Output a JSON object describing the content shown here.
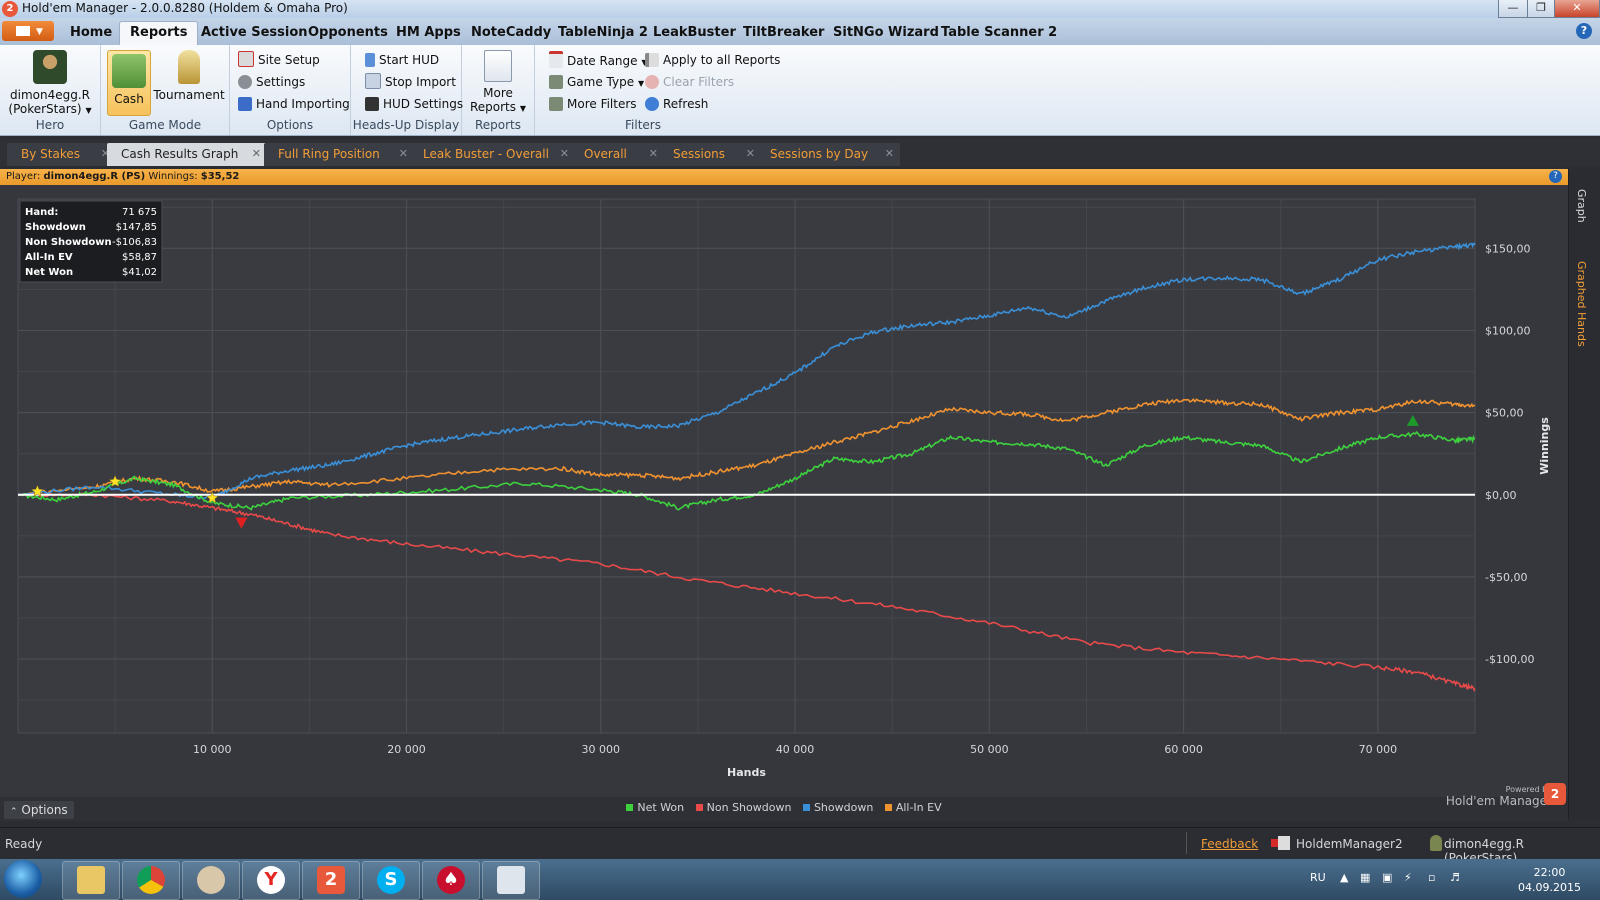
{
  "window": {
    "title": "Hold'em Manager - 2.0.0.8280 (Holdem & Omaha Pro)"
  },
  "menu": {
    "tabs": [
      "Home",
      "Reports",
      "Active Session",
      "Opponents",
      "HM Apps",
      "NoteCaddy",
      "TableNinja 2",
      "LeakBuster",
      "TiltBreaker",
      "SitNGo Wizard",
      "Table Scanner 2"
    ],
    "active": "Reports"
  },
  "ribbon": {
    "hero": {
      "name_line1": "dimon4egg.R",
      "name_line2": "(PokerStars)",
      "group": "Hero"
    },
    "game_mode": {
      "cash": "Cash",
      "tournament": "Tournament",
      "group": "Game Mode"
    },
    "options": {
      "site_setup": "Site Setup",
      "settings": "Settings",
      "hand_importing": "Hand Importing",
      "group": "Options"
    },
    "hud": {
      "start_hud": "Start HUD",
      "stop_import": "Stop Import",
      "hud_settings": "HUD Settings",
      "group": "Heads-Up Display"
    },
    "reports": {
      "more_line1": "More",
      "more_line2": "Reports",
      "group": "Reports"
    },
    "filters": {
      "date_range": "Date Range",
      "game_type": "Game Type",
      "more_filters": "More Filters",
      "apply_all": "Apply to all Reports",
      "clear_filters": "Clear Filters",
      "refresh": "Refresh",
      "group": "Filters"
    }
  },
  "doc_tabs": [
    "By Stakes",
    "Cash Results Graph",
    "Full Ring Position",
    "Leak Buster - Overall",
    "Overall",
    "Sessions",
    "Sessions by Day"
  ],
  "player_bar": {
    "player_label": "Player:",
    "player": "dimon4egg.R (PS)",
    "winnings_label": "Winnings:",
    "winnings": "$35,52"
  },
  "side_tabs": {
    "graph": "Graph",
    "graphed_hands": "Graphed Hands"
  },
  "stats_box": [
    {
      "label": "Hand:",
      "value": "71 675"
    },
    {
      "label": "Showdown",
      "value": "$147,85"
    },
    {
      "label": "Non Showdown",
      "value": "-$106,83"
    },
    {
      "label": "All-In EV",
      "value": "$58,87"
    },
    {
      "label": "Net Won",
      "value": "$41,02"
    }
  ],
  "chart_data": {
    "type": "line",
    "xlabel": "Hands",
    "ylabel": "Winnings",
    "xlim": [
      0,
      75000
    ],
    "ylim": [
      -145,
      180
    ],
    "x_ticks": [
      10000,
      20000,
      30000,
      40000,
      50000,
      60000,
      70000
    ],
    "x_tick_labels": [
      "10 000",
      "20 000",
      "30 000",
      "40 000",
      "50 000",
      "60 000",
      "70 000"
    ],
    "y_ticks": [
      150,
      100,
      50,
      0,
      -50,
      -100
    ],
    "y_tick_labels": [
      "$150,00",
      "$100,00",
      "$50,00",
      "$0,00",
      "-$50,00",
      "-$100,00"
    ],
    "grid": true,
    "series": [
      {
        "name": "Net Won",
        "color": "#3ed13e",
        "x": [
          0,
          2000,
          4000,
          6000,
          8000,
          10000,
          12000,
          14000,
          18000,
          22000,
          26000,
          30000,
          32000,
          34000,
          36000,
          38000,
          40000,
          42000,
          44000,
          46000,
          48000,
          50000,
          52000,
          54000,
          56000,
          58000,
          60000,
          62000,
          64000,
          66000,
          68000,
          70000,
          72000,
          74000,
          75000
        ],
        "y": [
          0,
          -3,
          2,
          10,
          6,
          -5,
          -8,
          -2,
          0,
          3,
          7,
          3,
          0,
          -8,
          -3,
          0,
          10,
          22,
          20,
          25,
          35,
          32,
          31,
          28,
          18,
          30,
          35,
          32,
          30,
          20,
          28,
          35,
          37,
          33,
          34
        ]
      },
      {
        "name": "Non Showdown",
        "color": "#e84a4a",
        "x": [
          0,
          4000,
          8000,
          10000,
          12000,
          14000,
          16000,
          20000,
          25000,
          30000,
          35000,
          40000,
          45000,
          50000,
          55000,
          60000,
          65000,
          70000,
          72000,
          74000,
          75000
        ],
        "y": [
          0,
          0,
          -4,
          -8,
          -12,
          -18,
          -24,
          -30,
          -36,
          -42,
          -52,
          -60,
          -68,
          -78,
          -90,
          -96,
          -100,
          -105,
          -108,
          -115,
          -118
        ]
      },
      {
        "name": "Showdown",
        "color": "#3b8fd6",
        "x": [
          0,
          4000,
          8000,
          10000,
          12000,
          14000,
          16000,
          18000,
          20000,
          22000,
          24000,
          26000,
          28000,
          30000,
          32000,
          34000,
          36000,
          38000,
          40000,
          42000,
          44000,
          46000,
          48000,
          50000,
          52000,
          54000,
          56000,
          58000,
          60000,
          62000,
          64000,
          66000,
          68000,
          70000,
          72000,
          74000,
          75000
        ],
        "y": [
          0,
          5,
          0,
          -2,
          10,
          15,
          18,
          24,
          30,
          34,
          37,
          40,
          43,
          44,
          41,
          42,
          50,
          62,
          74,
          90,
          99,
          103,
          105,
          109,
          114,
          108,
          118,
          126,
          131,
          132,
          131,
          122,
          131,
          143,
          148,
          151,
          152
        ]
      },
      {
        "name": "All-In EV",
        "color": "#f0922f",
        "x": [
          0,
          4000,
          6000,
          8000,
          10000,
          12000,
          14000,
          16000,
          20000,
          24000,
          28000,
          30000,
          32000,
          34000,
          36000,
          38000,
          40000,
          42000,
          44000,
          46000,
          48000,
          50000,
          52000,
          54000,
          56000,
          58000,
          60000,
          62000,
          64000,
          66000,
          68000,
          70000,
          72000,
          74000,
          75000
        ],
        "y": [
          0,
          5,
          10,
          8,
          2,
          5,
          8,
          6,
          10,
          15,
          16,
          12,
          12,
          10,
          14,
          18,
          25,
          32,
          38,
          45,
          52,
          50,
          49,
          45,
          50,
          55,
          58,
          56,
          55,
          46,
          50,
          52,
          57,
          55,
          54
        ]
      }
    ],
    "markers": [
      {
        "type": "star",
        "x": 1000,
        "y": 2,
        "color": "#ffe12a"
      },
      {
        "type": "star",
        "x": 5000,
        "y": 8,
        "color": "#ffe12a"
      },
      {
        "type": "star",
        "x": 10000,
        "y": -2,
        "color": "#ffe12a"
      },
      {
        "type": "down-triangle",
        "x": 11500,
        "y": -17,
        "color": "#e02020"
      },
      {
        "type": "up-triangle",
        "x": 71800,
        "y": 45,
        "color": "#1e9a2a"
      }
    ]
  },
  "legend": [
    "Net Won",
    "Non Showdown",
    "Showdown",
    "All-In EV"
  ],
  "bottom": {
    "options": "Options",
    "powered_small": "Powered by",
    "powered_big": "Hold'em Manager"
  },
  "statusbar": {
    "ready": "Ready",
    "feedback": "Feedback",
    "app": "HoldemManager2",
    "hero": "dimon4egg.R (PokerStars)"
  },
  "taskbar": {
    "lang": "RU",
    "time": "22:00",
    "date": "04.09.2015"
  }
}
